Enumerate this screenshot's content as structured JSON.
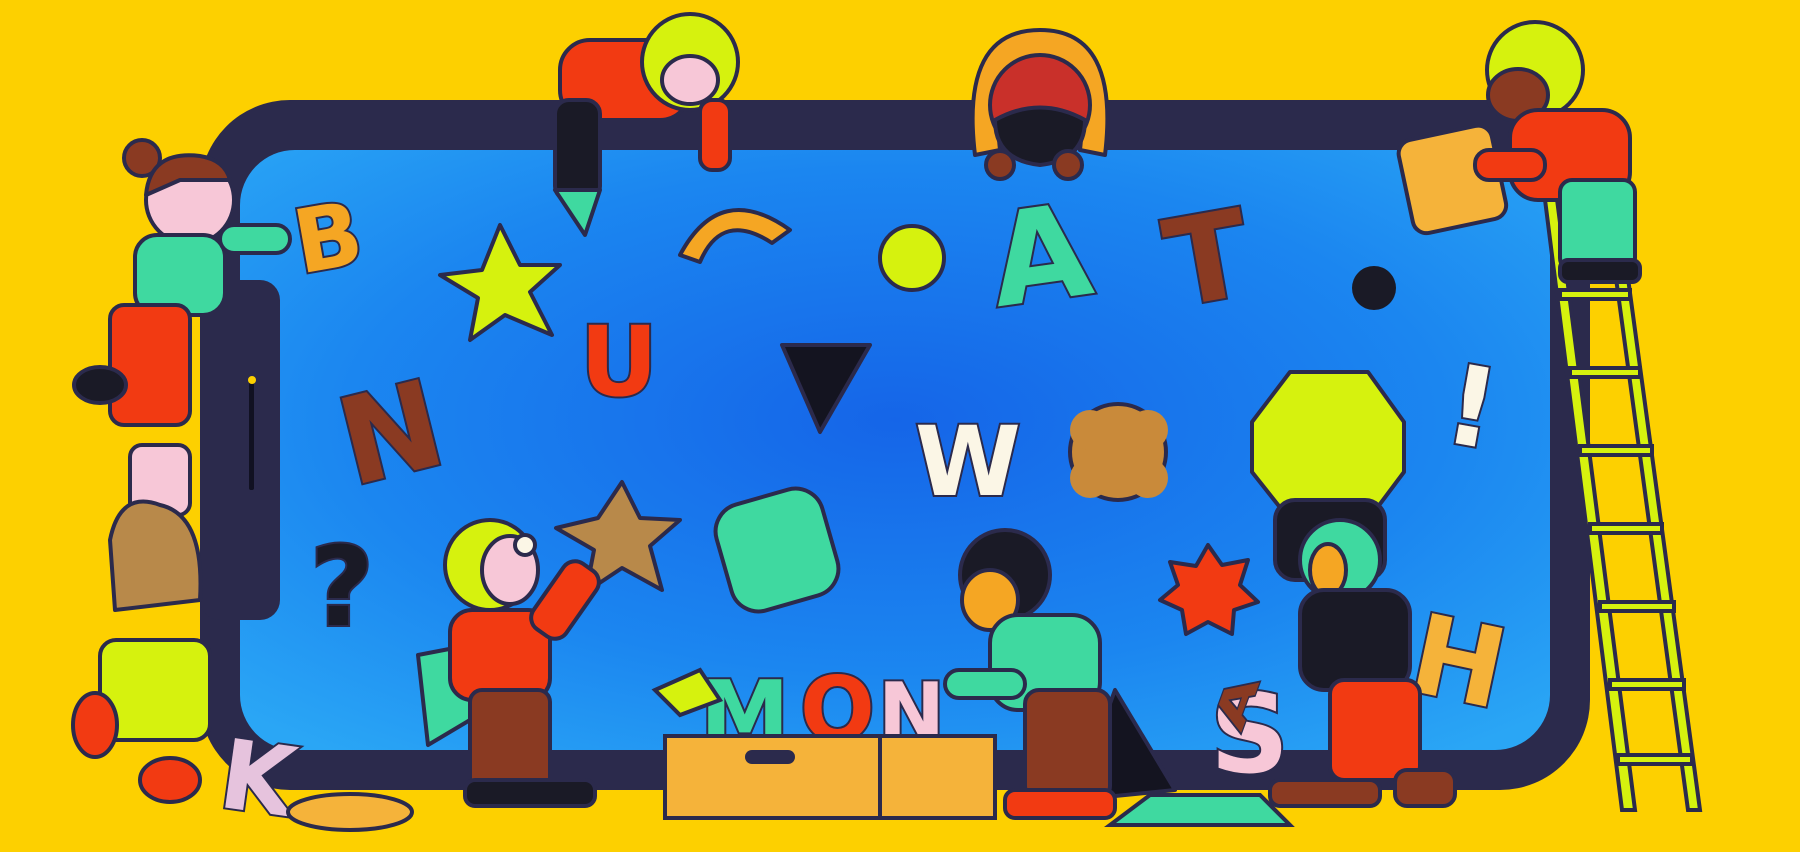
{
  "scene": {
    "background_color": "#fdd000",
    "phone_frame_color": "#2b2a4c",
    "screen_color": "#1e78f0",
    "palette": {
      "orange": "#f5a623",
      "lime": "#d6f20e",
      "mint": "#3fd9a0",
      "brown": "#8a3a22",
      "red": "#f23a12",
      "cream": "#fbf6e6",
      "pink": "#f7c7d7",
      "tan": "#c98a3a",
      "dark": "#222233"
    }
  },
  "letters": {
    "b": "B",
    "n": "N",
    "u": "U",
    "a": "A",
    "t": "T",
    "w": "W",
    "h": "H",
    "s": "S",
    "k": "K",
    "m": "M",
    "o": "O",
    "question": "?",
    "exclamation": "!",
    "a_floor": "A"
  }
}
